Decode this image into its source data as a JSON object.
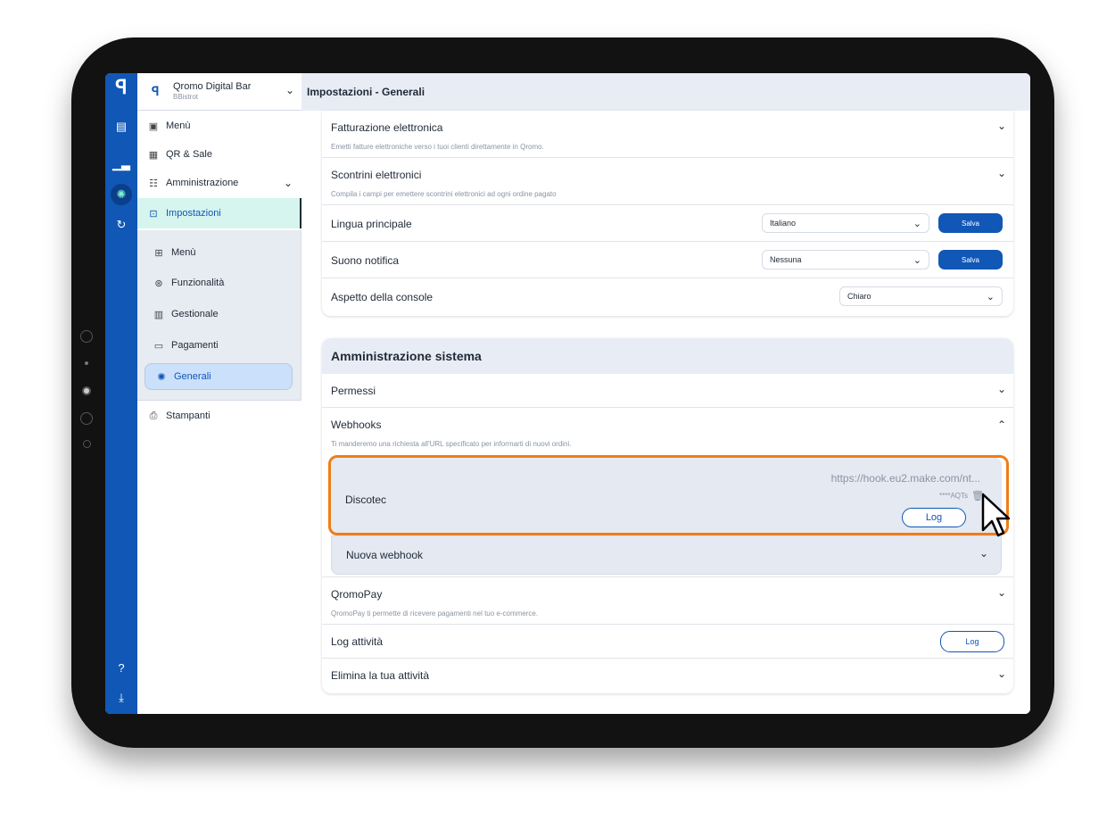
{
  "venue": {
    "name": "Qromo Digital Bar",
    "sub": "BBistrot"
  },
  "rail": {
    "icons": [
      "logo-icon",
      "receipt-icon",
      "chart-icon",
      "settings-icon",
      "refresh-icon",
      "help-icon",
      "download-icon"
    ]
  },
  "sidebar": {
    "top_items": [
      {
        "label": "Menù",
        "icon": "menu-book-icon"
      },
      {
        "label": "QR & Sale",
        "icon": "qr-icon"
      },
      {
        "label": "Amministrazione",
        "icon": "admin-icon"
      },
      {
        "label": "Impostazioni",
        "icon": "settings-icon"
      }
    ],
    "sub_items": [
      {
        "label": "Menù"
      },
      {
        "label": "Funzionalità"
      },
      {
        "label": "Gestionale"
      },
      {
        "label": "Pagamenti"
      },
      {
        "label": "Generali"
      }
    ],
    "bottom_items": [
      {
        "label": "Stampanti"
      }
    ]
  },
  "header": {
    "title": "Impostazioni - Generali"
  },
  "settings": {
    "fatturazione": {
      "title": "Fatturazione elettronica",
      "desc": "Emetti fatture elettroniche verso i tuoi clienti direttamente in Qromo."
    },
    "scontrini": {
      "title": "Scontrini elettronici",
      "desc": "Compila i campi per emettere scontrini elettronici ad ogni ordine pagato"
    },
    "lingua": {
      "title": "Lingua principale",
      "value": "Italiano",
      "save": "Salva"
    },
    "suono": {
      "title": "Suono notifica",
      "value": "Nessuna",
      "save": "Salva"
    },
    "aspetto": {
      "title": "Aspetto della console",
      "value": "Chiaro"
    }
  },
  "system": {
    "title": "Amministrazione sistema",
    "permessi": "Permessi",
    "webhooks": {
      "title": "Webhooks",
      "desc": "Ti manderemo una richiesta all'URL specificato per informarti di nuovi ordini."
    },
    "webhook_item": {
      "name": "Discotec",
      "url": "https://hook.eu2.make.com/nt...",
      "secret": "****AQTs",
      "log": "Log"
    },
    "new_webhook": "Nuova webhook",
    "qromopay": {
      "title": "QromoPay",
      "desc": "QromoPay ti permette di ricevere pagamenti nel tuo e-commerce."
    },
    "log_attivita": {
      "title": "Log attività",
      "button": "Log"
    },
    "elimina": "Elimina la tua attività"
  },
  "colors": {
    "brand": "#1057b6",
    "highlight": "#f07d17",
    "active_bg": "#d6f5ee"
  }
}
